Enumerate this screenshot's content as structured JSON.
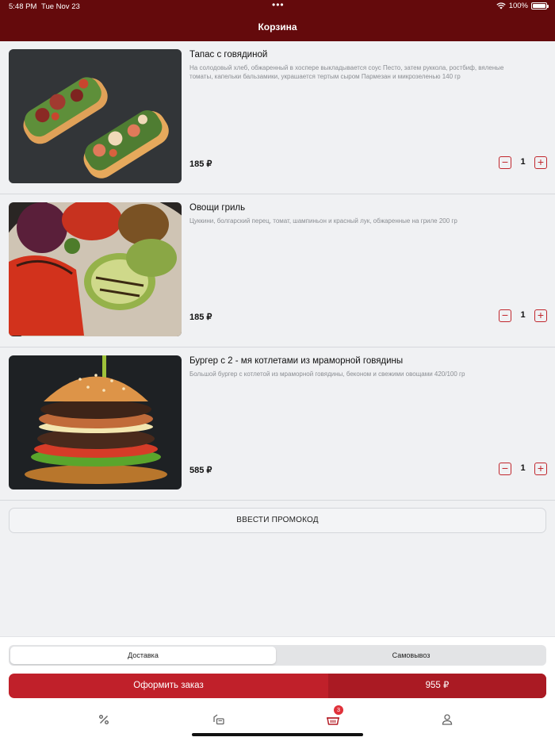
{
  "status_bar": {
    "time": "5:48 PM",
    "date": "Tue Nov 23",
    "battery": "100%"
  },
  "header": {
    "title": "Корзина"
  },
  "items": [
    {
      "name": "Тапас с говядиной",
      "description": "На солодовый хлеб, обжаренный в хоспере выкладывается соус Песто,  затем руккола, ростбиф, вяленые томаты, капельки бальзамики, украшается тертым сыром Пармезан и микрозеленью 140 гр",
      "price": "185 ₽",
      "quantity": "1"
    },
    {
      "name": "Овощи гриль",
      "description": "Цуккини, болгарский перец, томат, шампиньон и красный лук, обжаренные на гриле 200 гр",
      "price": "185 ₽",
      "quantity": "1"
    },
    {
      "name": "Бургер с 2 - мя котлетами из мраморной говядины",
      "description": "Большой бургер с котлетой из мраморной говядины, беконом и свежими овощами 420/100 гр",
      "price": "585 ₽",
      "quantity": "1"
    }
  ],
  "promo": {
    "label": "ВВЕСТИ ПРОМОКОД"
  },
  "delivery_toggle": {
    "options": [
      "Доставка",
      "Самовывоз"
    ],
    "selected": "Доставка"
  },
  "order": {
    "label": "Оформить заказ",
    "total": "955 ₽"
  },
  "tabbar": {
    "tabs": [
      {
        "icon": "percent-icon"
      },
      {
        "icon": "menu-icon"
      },
      {
        "icon": "basket-icon",
        "badge": "3"
      },
      {
        "icon": "profile-icon"
      }
    ]
  },
  "colors": {
    "header": "#640a0c",
    "accent": "#c0202a",
    "accent_dark": "#aa1a23",
    "badge": "#e0313a"
  }
}
